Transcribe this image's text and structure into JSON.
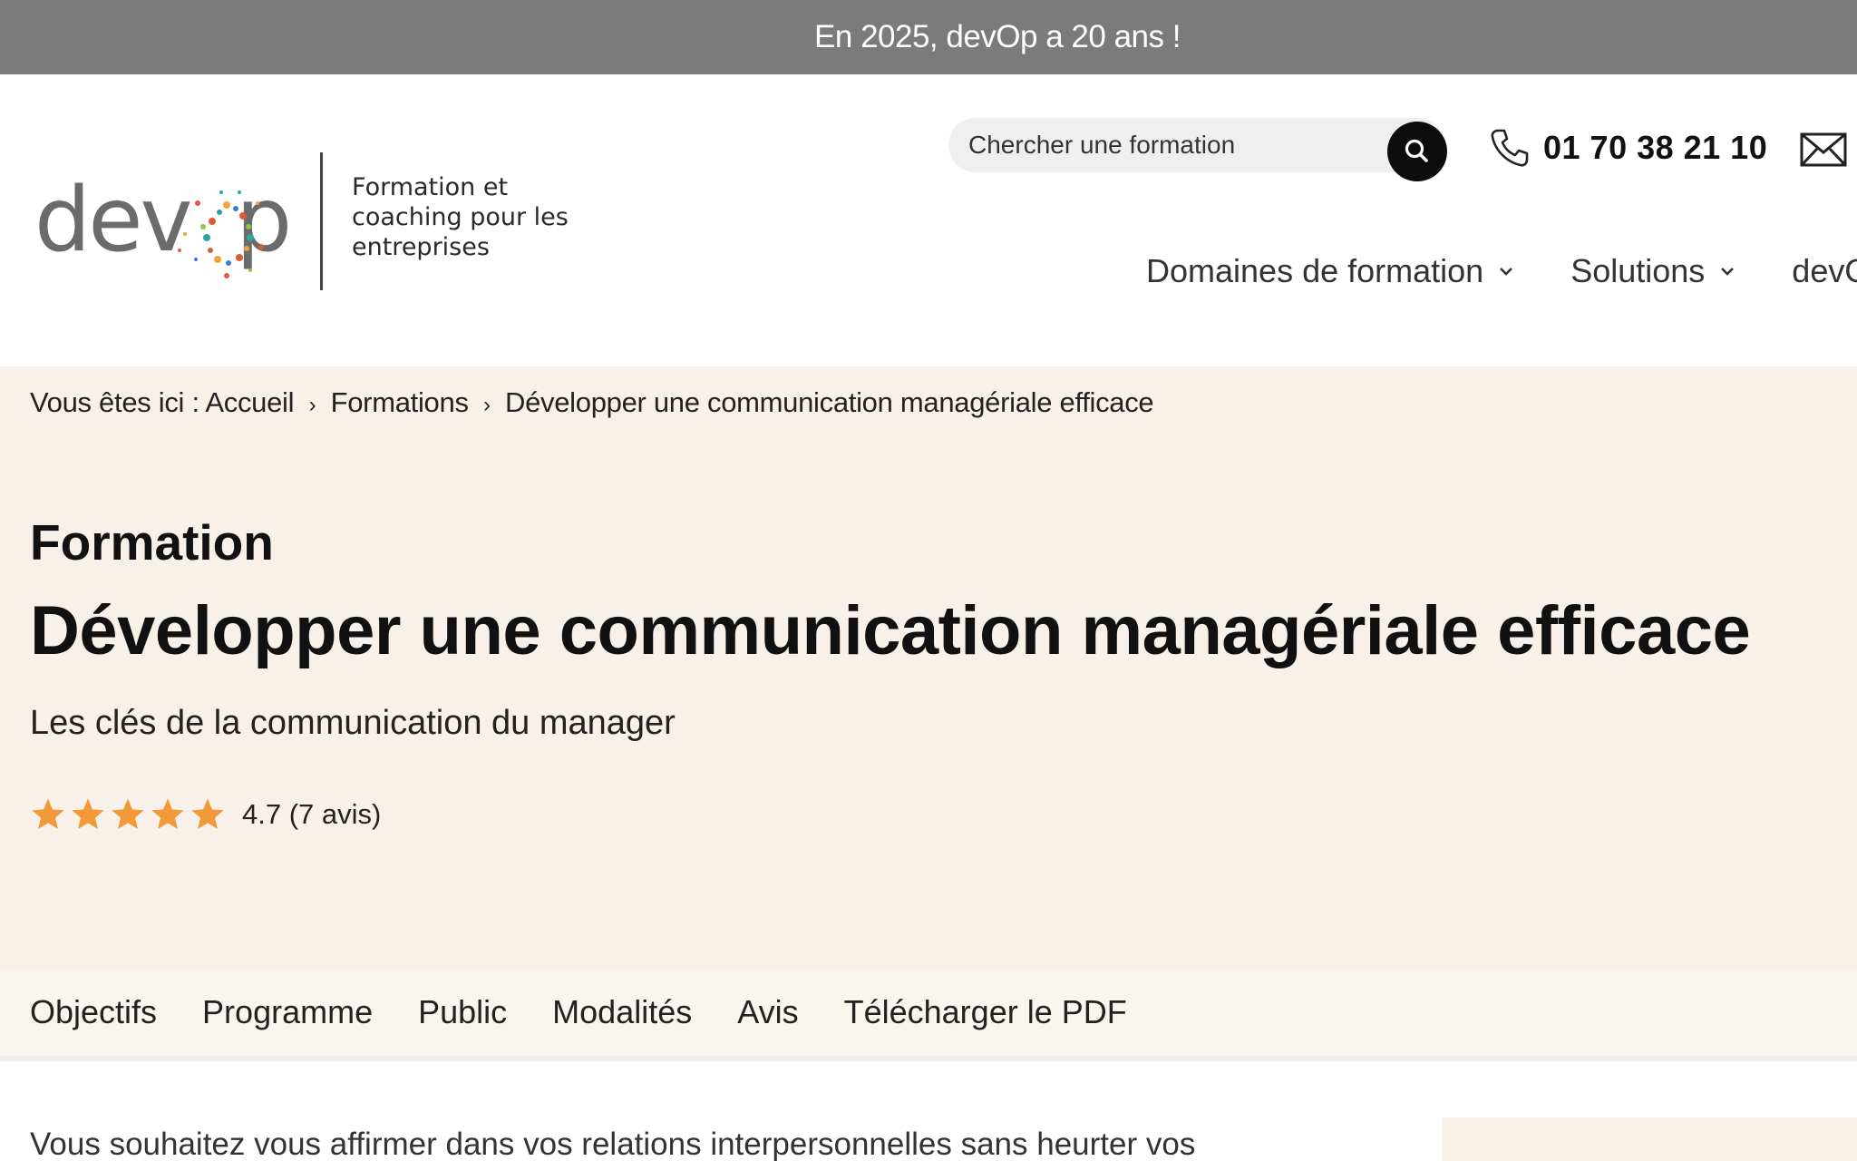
{
  "announcement": "En 2025, devOp a 20 ans !",
  "logo": {
    "wordmark": "devOp",
    "tagline": "Formation et coaching pour les entreprises"
  },
  "search": {
    "placeholder": "Chercher une formation"
  },
  "contact": {
    "phone": "01 70 38 21 10"
  },
  "nav": {
    "items": [
      {
        "label": "Domaines de formation"
      },
      {
        "label": "Solutions"
      },
      {
        "label": "devOp"
      }
    ]
  },
  "breadcrumb": {
    "prefix": "Vous êtes ici :",
    "items": [
      "Accueil",
      "Formations",
      "Développer une communication managériale efficace"
    ]
  },
  "hero": {
    "kicker": "Formation",
    "title": "Développer une communication managériale efficace",
    "subtitle": "Les clés de la communication du manager",
    "rating": {
      "score": 4.7,
      "max": 5,
      "text": "4.7 (7 avis)"
    }
  },
  "tabs": [
    "Objectifs",
    "Programme",
    "Public",
    "Modalités",
    "Avis",
    "Télécharger le PDF"
  ],
  "intro": "Vous souhaitez vous affirmer dans vos relations interpersonnelles sans heurter vos",
  "colors": {
    "topbar": "#7b7b7b",
    "hero_bg": "#f8f1ea",
    "star": "#f29a38",
    "search_btn": "#0d0d0d"
  },
  "icons": [
    "search-icon",
    "phone-icon",
    "mail-icon",
    "chevron-down-icon",
    "star-icon"
  ]
}
